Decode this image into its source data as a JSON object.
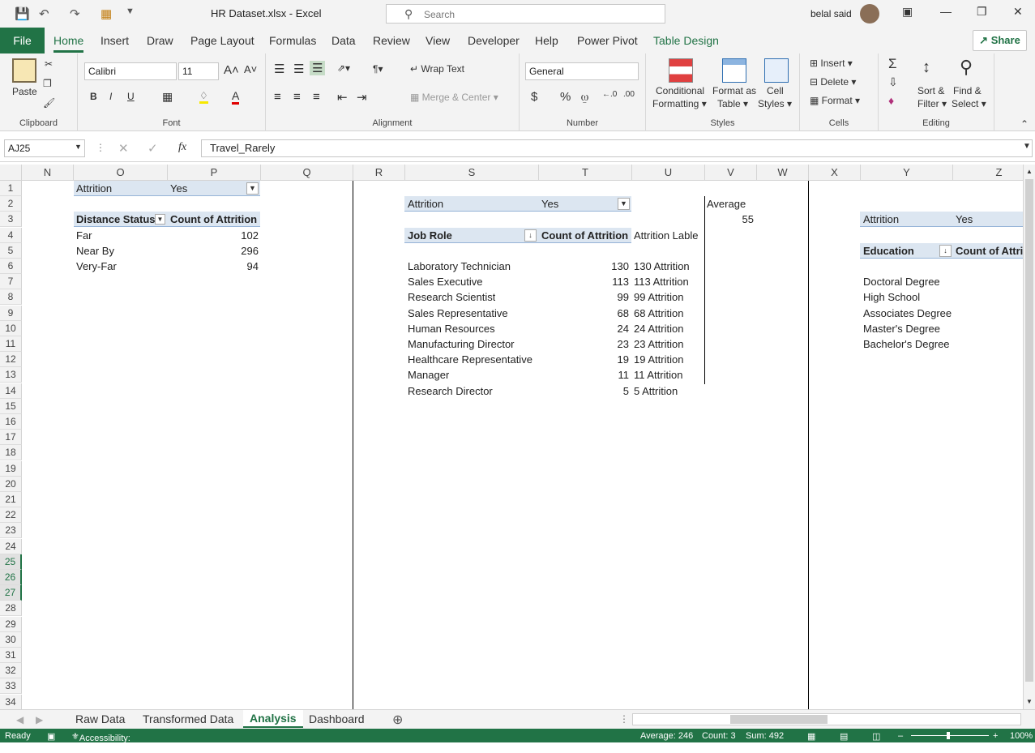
{
  "window": {
    "title": "HR Dataset.xlsx  -  Excel",
    "search_placeholder": "Search",
    "user": "belal said"
  },
  "ribbon_tabs": [
    "File",
    "Home",
    "Insert",
    "Draw",
    "Page Layout",
    "Formulas",
    "Data",
    "Review",
    "View",
    "Developer",
    "Help",
    "Power Pivot",
    "Table Design"
  ],
  "share_label": "Share",
  "ribbon": {
    "clipboard": {
      "paste": "Paste",
      "label": "Clipboard"
    },
    "font": {
      "name": "Calibri",
      "size": "11",
      "label": "Font"
    },
    "alignment": {
      "wrap": "Wrap Text",
      "merge": "Merge & Center",
      "label": "Alignment"
    },
    "number": {
      "format": "General",
      "label": "Number"
    },
    "styles": {
      "cond1": "Conditional",
      "cond2": "Formatting",
      "fmt1": "Format as",
      "fmt2": "Table",
      "cell1": "Cell",
      "cell2": "Styles",
      "label": "Styles"
    },
    "cells": {
      "insert": "Insert",
      "delete": "Delete",
      "format": "Format",
      "label": "Cells"
    },
    "editing": {
      "sort1": "Sort &",
      "sort2": "Filter",
      "find1": "Find &",
      "find2": "Select",
      "label": "Editing"
    }
  },
  "formula_bar": {
    "namebox": "AJ25",
    "fx": "fx",
    "value": "Travel_Rarely"
  },
  "columns": [
    "N",
    "O",
    "P",
    "Q",
    "R",
    "S",
    "T",
    "U",
    "V",
    "W",
    "X",
    "Y",
    "Z"
  ],
  "rows": [
    "1",
    "2",
    "3",
    "4",
    "5",
    "6",
    "7",
    "8",
    "9",
    "10",
    "11",
    "12",
    "13",
    "14",
    "15",
    "16",
    "17",
    "18",
    "19",
    "20",
    "21",
    "22",
    "23",
    "24",
    "25",
    "26",
    "27",
    "28",
    "29",
    "30",
    "31",
    "32",
    "33",
    "34"
  ],
  "selected_rows": [
    "25",
    "26",
    "27"
  ],
  "pivot1": {
    "filter_label": "Attrition",
    "filter_value": "Yes",
    "h1": "Distance Status",
    "h2": "Count of Attrition",
    "rows": [
      {
        "k": "Far",
        "v": "102"
      },
      {
        "k": "Near By",
        "v": "296"
      },
      {
        "k": "Very-Far",
        "v": "94"
      }
    ]
  },
  "pivot2": {
    "filter_label": "Attrition",
    "filter_value": "Yes",
    "h1": "Job Role",
    "h2": "Count of Attrition",
    "h3": "Attrition Lable",
    "rows": [
      {
        "k": "Laboratory Technician",
        "v": "130",
        "l": "130 Attrition"
      },
      {
        "k": "Sales Executive",
        "v": "113",
        "l": "113 Attrition"
      },
      {
        "k": "Research Scientist",
        "v": "99",
        "l": "99 Attrition"
      },
      {
        "k": "Sales Representative",
        "v": "68",
        "l": "68 Attrition"
      },
      {
        "k": "Human Resources",
        "v": "24",
        "l": "24 Attrition"
      },
      {
        "k": "Manufacturing Director",
        "v": "23",
        "l": "23 Attrition"
      },
      {
        "k": "Healthcare Representative",
        "v": "19",
        "l": "19 Attrition"
      },
      {
        "k": "Manager",
        "v": "11",
        "l": "11 Attrition"
      },
      {
        "k": "Research Director",
        "v": "5",
        "l": "5 Attrition"
      }
    ],
    "avg_label": "Average",
    "avg_value": "55"
  },
  "pivot3": {
    "filter_label": "Attrition",
    "filter_value": "Yes",
    "h1": "Education",
    "h2": "Count of Attri",
    "rows": [
      "Doctoral Degree",
      "High School",
      "Associates Degree",
      "Master's Degree",
      "Bachelor's Degree"
    ]
  },
  "sheet_tabs": [
    "Raw Data",
    "Transformed Data",
    "Analysis",
    "Dashboard"
  ],
  "active_sheet": "Analysis",
  "status": {
    "ready": "Ready",
    "accessibility": "Accessibility: Investigate",
    "average": "Average: 246",
    "count": "Count: 3",
    "sum": "Sum: 492",
    "zoom": "100%"
  },
  "colors": {
    "accent": "#217346",
    "pivot_header": "#dce6f1"
  }
}
